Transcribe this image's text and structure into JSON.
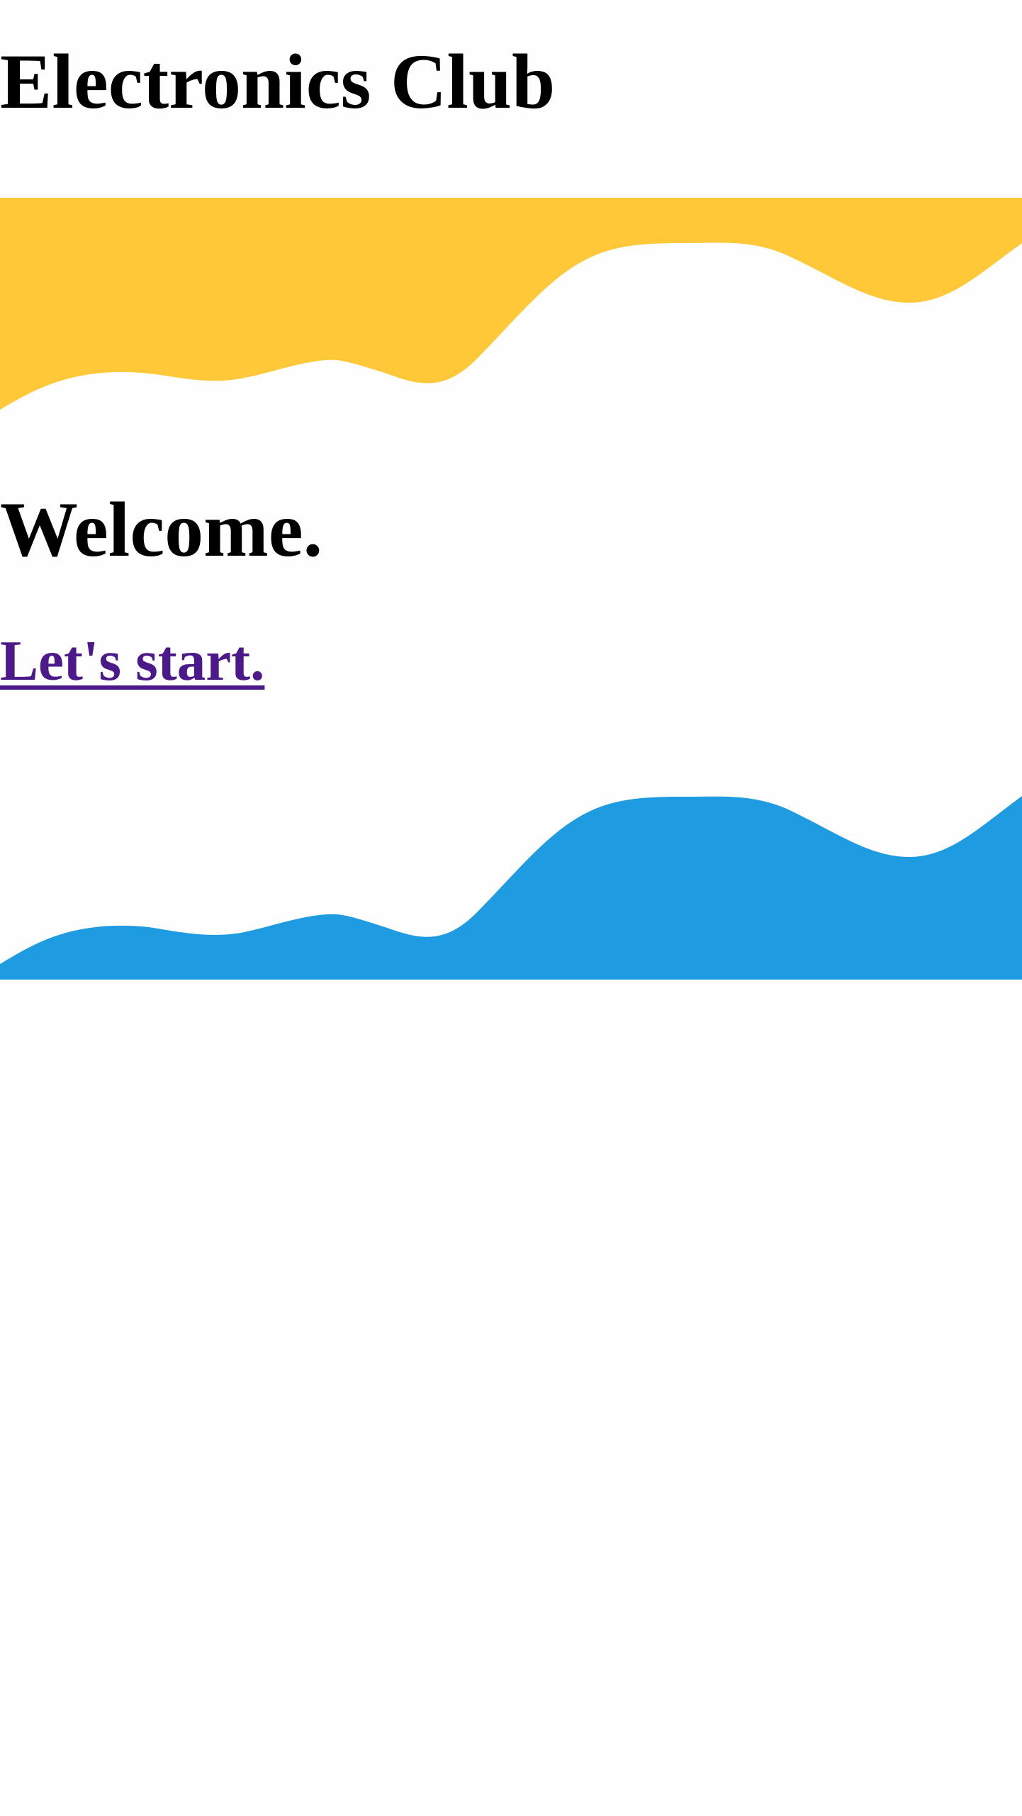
{
  "header": {
    "title": "Electronics Club"
  },
  "decor": {
    "top_wave_color": "#FEC839",
    "bottom_wave_color": "#1F9CE1"
  },
  "main": {
    "heading": "Welcome.",
    "cta": {
      "label": "Let's start.",
      "color": "#4B1989"
    }
  }
}
